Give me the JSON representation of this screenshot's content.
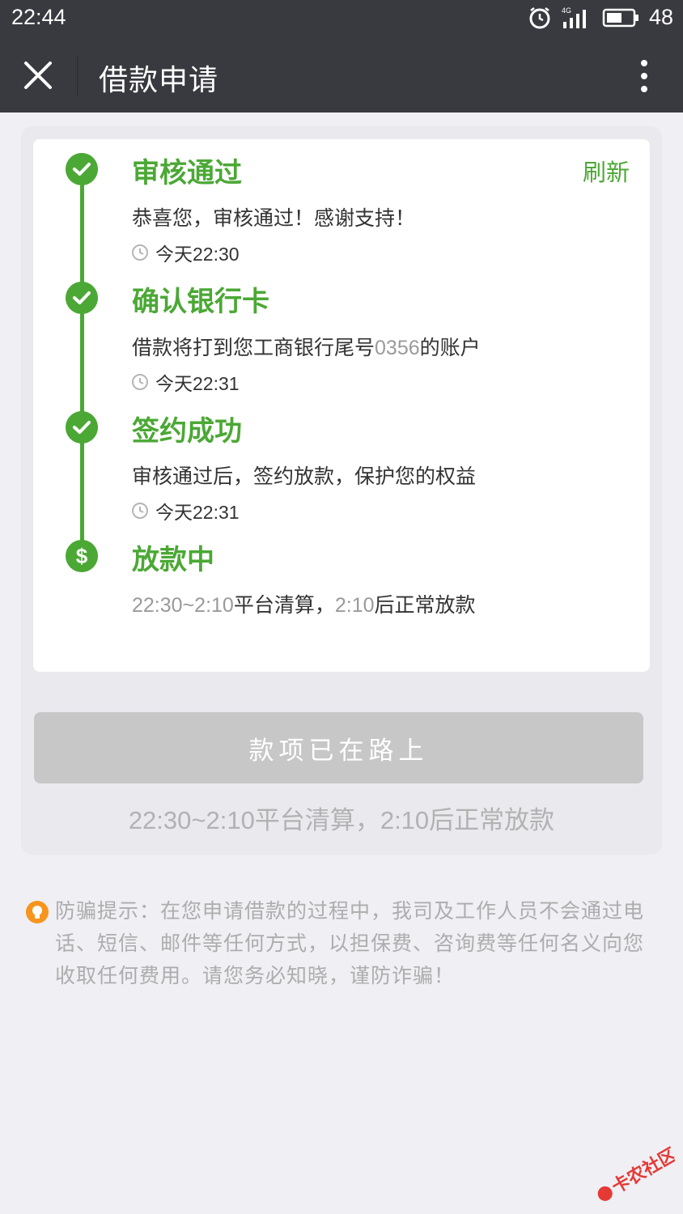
{
  "status_bar": {
    "time": "22:44",
    "network": "4G",
    "battery": "48",
    "icons": [
      "alarm-icon",
      "signal-icon",
      "battery-icon"
    ]
  },
  "nav": {
    "title": "借款申请",
    "close_icon": "close-icon",
    "more_icon": "more-vertical-icon"
  },
  "timeline": {
    "refresh_label": "刷新",
    "accent_color": "#4ba835",
    "steps": [
      {
        "title": "审核通过",
        "desc": "恭喜您，审核通过！感谢支持！",
        "time": "今天22:30",
        "icon": "check-icon"
      },
      {
        "title": "确认银行卡",
        "desc_prefix": "借款将打到您工商银行尾号",
        "desc_num": "0356",
        "desc_suffix": "的账户",
        "time": "今天22:31",
        "icon": "check-icon"
      },
      {
        "title": "签约成功",
        "desc": "审核通过后，签约放款，保护您的权益",
        "time": "今天22:31",
        "icon": "check-icon"
      },
      {
        "title": "放款中",
        "desc_num1": "22:30~2:10",
        "desc_mid": "平台清算，",
        "desc_num2": "2:10",
        "desc_suffix": "后正常放款",
        "icon": "dollar-icon"
      }
    ]
  },
  "button": {
    "label": "款项已在路上",
    "note_num1": "22:30~2:10",
    "note_mid": "平台清算，",
    "note_num2": "2:10",
    "note_suffix": "后正常放款"
  },
  "notice": {
    "icon": "bulb-icon",
    "text": "防骗提示：在您申请借款的过程中，我司及工作人员不会通过电话、短信、邮件等任何方式，以担保费、咨询费等任何名义向您收取任何费用。请您务必知晓，谨防诈骗！"
  },
  "watermark": {
    "text": "卡农社区"
  }
}
